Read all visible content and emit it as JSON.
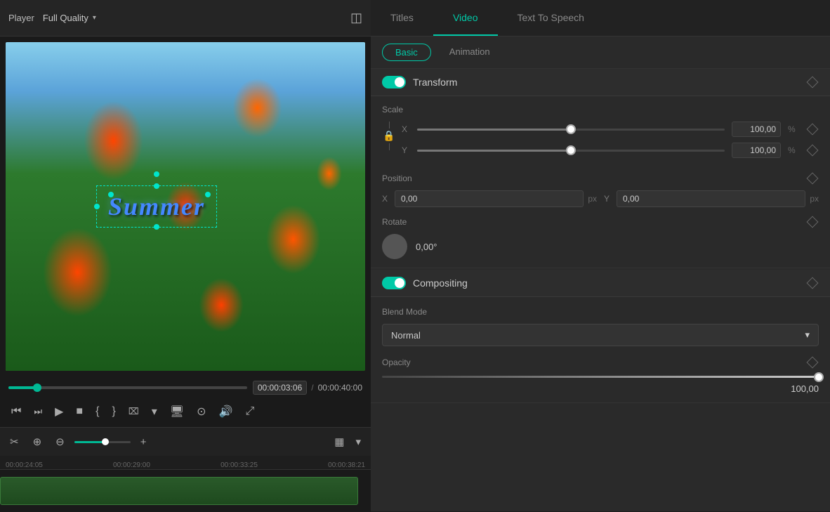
{
  "left": {
    "player_label": "Player",
    "quality": "Full Quality",
    "time_current": "00:00:03:06",
    "time_separator": "/",
    "time_total": "00:00:40:00",
    "ruler_marks": [
      "00:00:24:05",
      "00:00:29:00",
      "00:00:33:25",
      "00:00:38:21"
    ],
    "video_text": "Summer"
  },
  "right": {
    "tabs": [
      {
        "label": "Titles",
        "active": false
      },
      {
        "label": "Video",
        "active": true
      },
      {
        "label": "Text To Speech",
        "active": false
      }
    ],
    "sub_tabs": [
      {
        "label": "Basic",
        "active": true
      },
      {
        "label": "Animation",
        "active": false
      }
    ],
    "transform": {
      "title": "Transform",
      "scale_label": "Scale",
      "scale_x_value": "100,00",
      "scale_x_unit": "%",
      "scale_y_value": "100,00",
      "scale_y_unit": "%",
      "position_label": "Position",
      "pos_x_label": "X",
      "pos_x_value": "0,00",
      "pos_x_unit": "px",
      "pos_y_label": "Y",
      "pos_y_value": "0,00",
      "pos_y_unit": "px",
      "rotate_label": "Rotate",
      "rotate_value": "0,00°"
    },
    "compositing": {
      "title": "Compositing",
      "blend_mode_label": "Blend Mode",
      "blend_value": "Normal",
      "opacity_label": "Opacity",
      "opacity_value": "100,00"
    }
  },
  "icons": {
    "histogram": "⬜",
    "step_back": "⏮",
    "step_frame": "⏭",
    "play": "▶",
    "stop": "■",
    "mark_in": "{",
    "mark_out": "}",
    "overlay": "⊞",
    "snapshot": "📷",
    "volume": "🔊",
    "fullscreen": "⛶",
    "scissors": "✂",
    "add_track": "➕",
    "remove_track": "➖",
    "grid": "▦",
    "chevron_down": "▾"
  }
}
